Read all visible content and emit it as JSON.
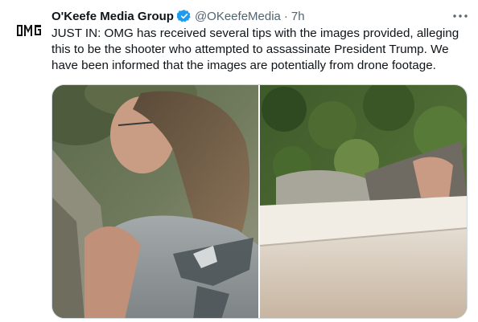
{
  "tweet": {
    "author_name": "O'Keefe Media Group",
    "handle": "@OKeefeMedia",
    "separator": "·",
    "time": "7h",
    "avatar_text": "OMG",
    "verified_color": "#1d9bf0",
    "text_lines": [
      "JUST IN: OMG has received several tips with the images provided, alleging",
      "this to be the shooter who attempted to assassinate President Trump. We",
      "have been informed that the images are potentially from drone footage."
    ]
  },
  "icons": {
    "verified": "verified-badge-icon",
    "more": "more-options-icon"
  },
  "colors": {
    "text": "#0f1419",
    "secondary": "#536471",
    "border": "#cfd9de"
  }
}
